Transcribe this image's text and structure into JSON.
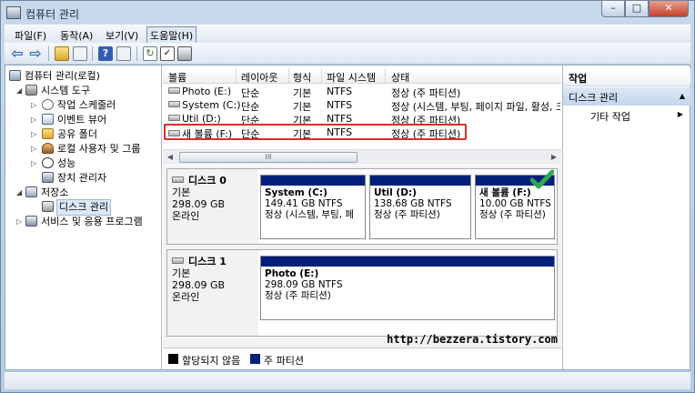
{
  "window": {
    "title": "컴퓨터 관리"
  },
  "menu": [
    "파일(F)",
    "동작(A)",
    "보기(V)",
    "도움말(H)"
  ],
  "tree": {
    "root": "컴퓨터 관리(로컬)",
    "system_tools": "시스템 도구",
    "task_scheduler": "작업 스케줄러",
    "event_viewer": "이벤트 뷰어",
    "shared_folders": "공유 폴더",
    "local_users": "로컬 사용자 및 그룹",
    "performance": "성능",
    "device_manager": "장치 관리자",
    "storage": "저장소",
    "disk_management": "디스크 관리",
    "services": "서비스 및 응용 프로그램"
  },
  "volume_list": {
    "columns": [
      "볼륨",
      "레이아웃",
      "형식",
      "파일 시스템",
      "상태"
    ],
    "rows": [
      {
        "volume": "Photo (E:)",
        "layout": "단순",
        "type": "기본",
        "fs": "NTFS",
        "status": "정상 (주 파티션)"
      },
      {
        "volume": "System (C:)",
        "layout": "단순",
        "type": "기본",
        "fs": "NTFS",
        "status": "정상 (시스템, 부팅, 페이지 파일, 활성, 크"
      },
      {
        "volume": "Util (D:)",
        "layout": "단순",
        "type": "기본",
        "fs": "NTFS",
        "status": "정상 (주 파티션)"
      },
      {
        "volume": "새 볼륨 (F:)",
        "layout": "단순",
        "type": "기본",
        "fs": "NTFS",
        "status": "정상 (주 파티션)"
      }
    ],
    "scroll_grip": "III"
  },
  "disks": [
    {
      "name": "디스크 0",
      "type": "기본",
      "size": "298.09 GB",
      "state": "온라인",
      "partitions": [
        {
          "name": "System  (C:)",
          "size": "149.41 GB NTFS",
          "status": "정상 (시스템, 부팅, 페"
        },
        {
          "name": "Util  (D:)",
          "size": "138.68 GB NTFS",
          "status": "정상 (주 파티션)"
        },
        {
          "name": "새 볼륨  (F:)",
          "size": "10.00 GB NTFS",
          "status": "정상 (주 파티션)"
        }
      ]
    },
    {
      "name": "디스크 1",
      "type": "기본",
      "size": "298.09 GB",
      "state": "온라인",
      "partitions": [
        {
          "name": "Photo  (E:)",
          "size": "298.09 GB NTFS",
          "status": "정상 (주 파티션)"
        }
      ]
    }
  ],
  "legend": {
    "unallocated": "할당되지 않음",
    "primary": "주 파티션",
    "unallocated_color": "#000000",
    "primary_color": "#00207a"
  },
  "watermark": "http://bezzera.tistory.com",
  "actions": {
    "header": "작업",
    "section": "디스크 관리",
    "item": "기타 작업"
  },
  "colors": {
    "partition_bar": "#00207a",
    "highlight": "#d32f2f",
    "check": "#2fa84f"
  }
}
